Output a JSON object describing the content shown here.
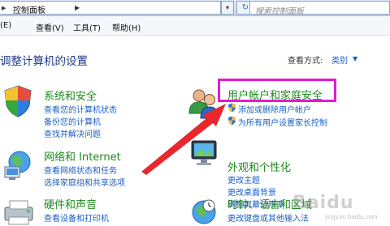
{
  "address": {
    "breadcrumb": "控制面板",
    "search_placeholder": "搜索控制面板"
  },
  "menu": {
    "edit": "(E)",
    "view": "查看(V)",
    "tools": "工具(T)",
    "help": "帮助(H)"
  },
  "page": {
    "title": "调整计算机的设置",
    "view_by_label": "查看方式:",
    "view_by_value": "类别"
  },
  "categories": {
    "system": {
      "title": "系统和安全",
      "links": [
        "查看您的计算机状态",
        "备份您的计算机",
        "查找并解决问题"
      ]
    },
    "network": {
      "title": "网络和 Internet",
      "links": [
        "查看网络状态和任务",
        "选择家庭组和共享选项"
      ]
    },
    "hardware": {
      "title": "硬件和声音",
      "links": [
        "查看设备和打印机"
      ]
    },
    "user": {
      "title": "用户帐户和家庭安全",
      "links": [
        "添加或删除用户帐户",
        "为所有用户设置家长控制"
      ]
    },
    "appearance": {
      "title": "外观和个性化",
      "links": [
        "更改主题",
        "更改桌面背景",
        "调整屏幕分辨率"
      ]
    },
    "clock": {
      "title": "时钟、语言和区域",
      "links": [
        "更改键盘或其他输入法"
      ]
    }
  },
  "watermark": {
    "text": "Baidu",
    "sub": "jingyan.baidu.com"
  },
  "colors": {
    "link": "#1a5fc7",
    "category_title": "#1d8a1d",
    "highlight": "#e21ad6",
    "annotation_arrow": "#e8282c"
  },
  "icons": [
    "folder-icon",
    "dropdown-arrow-icon",
    "refresh-icon",
    "security-shield-icon",
    "network-globe-icon",
    "printer-icon",
    "users-icon",
    "uac-shield-icon",
    "appearance-monitor-icon",
    "clock-globe-icon"
  ]
}
